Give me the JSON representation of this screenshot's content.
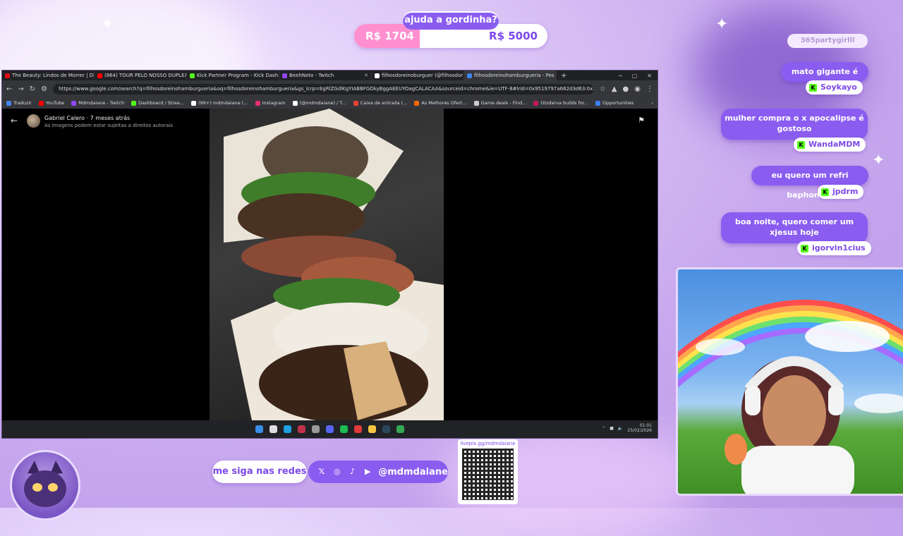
{
  "goal": {
    "title": "ajuda a gordinha?",
    "current": "R$ 1704",
    "target": "R$ 5000",
    "progress": 0.34
  },
  "browser": {
    "tabs": [
      {
        "label": "The Beauty: Lindos de Morrer | Dis",
        "icon": "netflix-icon",
        "color": "#e50914"
      },
      {
        "label": "(864) TOUR PELO NOSSO DUPLEX",
        "icon": "youtube-icon",
        "color": "#ff0000"
      },
      {
        "label": "Kick Partner Program - Kick Dash",
        "icon": "kick-icon",
        "color": "#53fc18"
      },
      {
        "label": "BeehNeto - Twitch",
        "icon": "twitch-icon",
        "color": "#9146ff"
      },
      {
        "label": "filhosdoreinoburguer (@filhosdor",
        "icon": "tiktok-icon",
        "color": "#ffffff"
      },
      {
        "label": "filhosdoreinohamburgueria - Pes",
        "icon": "google-icon",
        "color": "#4285f4"
      }
    ],
    "url": "https://www.google.com/search?q=filhosdoreinohamburgueria&oq=filhosdoreinohamburgueria&gs_lcrp=EgRlZGdlKgYIABBFGDkyBggAEEUYOagCALACAA&sourceid=chrome&ie=UTF-8#lrid=0x9519797a662d3d63:0x34a4...",
    "bookmarks": [
      {
        "label": "Traduzir",
        "color": "#4285f4"
      },
      {
        "label": "YouTube",
        "color": "#ff0000"
      },
      {
        "label": "Mdmdaiane - Twitch",
        "color": "#9146ff"
      },
      {
        "label": "Dashboard / Strea...",
        "color": "#53fc18"
      },
      {
        "label": "(99+) mdmdaiane (...",
        "color": "#ffffff"
      },
      {
        "label": "Instagram",
        "color": "#e1306c"
      },
      {
        "label": "(@mdmdaiane) / T...",
        "color": "#ffffff"
      },
      {
        "label": "Caixa de entrada (...",
        "color": "#ea4335"
      },
      {
        "label": "As Melhores Ofert...",
        "color": "#ff6a00"
      },
      {
        "label": "Game deals - Find...",
        "color": "#cccccc"
      },
      {
        "label": "Otzdarva builds for...",
        "color": "#c2185b"
      },
      {
        "label": "Opportunities",
        "color": "#3b82f6"
      }
    ],
    "viewer": {
      "author": "Gabriel Calero · 7 meses atrás",
      "rights": "As imagens podem estar sujeitas a direitos autorais"
    },
    "taskbar": {
      "time": "01:01",
      "date": "25/02/2026"
    }
  },
  "chat": {
    "top_user": "365partygirlll",
    "messages": [
      {
        "text": "mato gigante é essa",
        "user": "Soykayo"
      },
      {
        "text": "mulher compra o x apocalipse é gostoso",
        "user": "WandaMDM"
      },
      {
        "text": "eu quero um refri baphomed",
        "user": "jpdrm"
      },
      {
        "text": "boa noite, quero comer um xjesus hoje",
        "user": "igorvin1cius"
      }
    ]
  },
  "social": {
    "label": "me siga nas redes",
    "handle": "@mdmdaiane",
    "icons": [
      "x-icon",
      "instagram-icon",
      "tiktok-icon",
      "youtube-icon"
    ]
  },
  "qr": {
    "label": "livepix.gg/mdmdaiane"
  },
  "colors": {
    "accent": "#8a5cf0",
    "kick": "#53fc18",
    "pink": "#ff8fcf"
  }
}
